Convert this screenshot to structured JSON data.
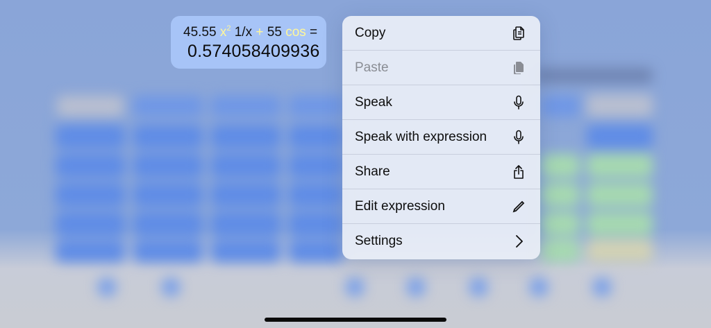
{
  "expression": {
    "number1": "45.55",
    "op_square": "x",
    "op_square_exp": "2",
    "op_reciprocal": "1/x",
    "op_plus": "+",
    "number2": "55",
    "op_cos": "cos",
    "equals": "=",
    "result": "0.574058409936"
  },
  "menu": {
    "items": [
      {
        "label": "Copy",
        "icon": "copy-icon",
        "enabled": true
      },
      {
        "label": "Paste",
        "icon": "paste-icon",
        "enabled": false
      },
      {
        "label": "Speak",
        "icon": "microphone-icon",
        "enabled": true
      },
      {
        "label": "Speak with expression",
        "icon": "microphone-icon",
        "enabled": true
      },
      {
        "label": "Share",
        "icon": "share-icon",
        "enabled": true
      },
      {
        "label": "Edit expression",
        "icon": "pencil-icon",
        "enabled": true
      },
      {
        "label": "Settings",
        "icon": "chevron-right-icon",
        "enabled": true
      }
    ]
  },
  "colors": {
    "operator_highlight": "#fff79a",
    "bubble_background": "#a7c4f7",
    "menu_background": "#e9eef6"
  }
}
